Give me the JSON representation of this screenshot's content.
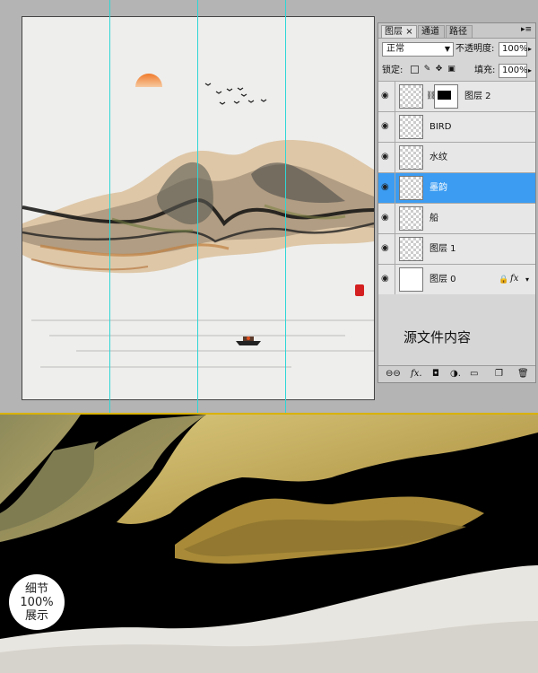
{
  "panel": {
    "tabs": [
      {
        "label": "图层",
        "close": "×"
      },
      {
        "label": "通道"
      },
      {
        "label": "路径"
      }
    ],
    "menu_icon": "panel-menu-icon",
    "blend_mode": "正常",
    "opacity_label": "不透明度:",
    "opacity_value": "100%",
    "lock_label": "锁定:",
    "fill_label": "填充:",
    "fill_value": "100%",
    "layers": [
      {
        "name": "图层 2",
        "thumb": "transparent",
        "has_mask": true,
        "selected": false
      },
      {
        "name": "BIRD",
        "thumb": "transparent",
        "selected": false
      },
      {
        "name": "水纹",
        "thumb": "transparent",
        "selected": false
      },
      {
        "name": "墨韵",
        "thumb": "transparent",
        "selected": true
      },
      {
        "name": "船",
        "thumb": "transparent",
        "selected": false
      },
      {
        "name": "图层 1",
        "thumb": "transparent",
        "selected": false
      },
      {
        "name": "图层 0",
        "thumb": "white",
        "locked": true,
        "fx": "fx",
        "selected": false
      }
    ],
    "source_label": "源文件内容"
  },
  "badge": {
    "line1": "细节",
    "line2": "100%",
    "line3": "展示"
  },
  "colors": {
    "sun": "#f08a3a",
    "seal": "#d42020",
    "selection": "#3b9cf2",
    "guide": "#2fd6d6"
  }
}
